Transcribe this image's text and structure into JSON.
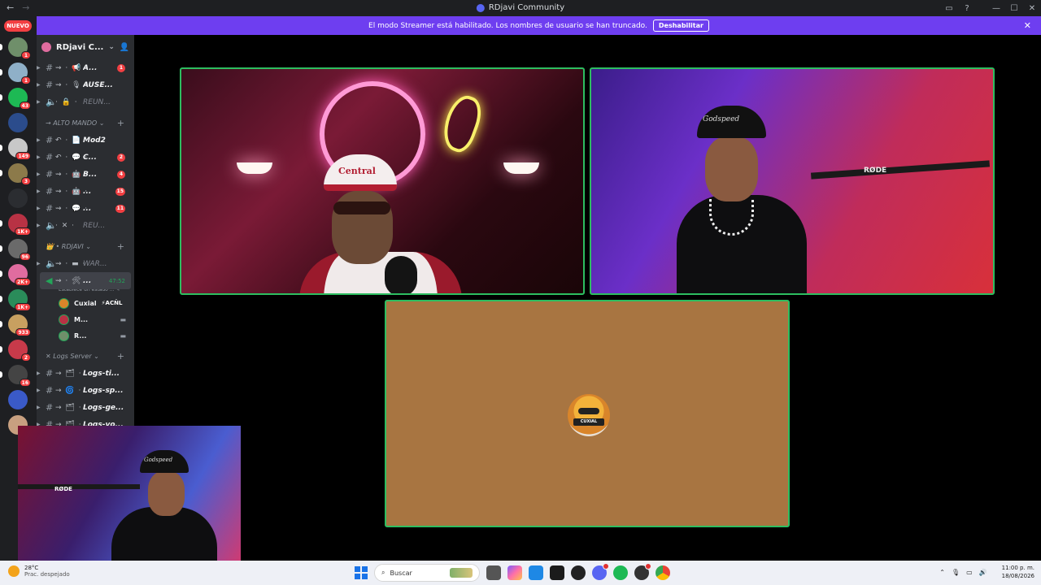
{
  "window": {
    "title": "RDjavi Community",
    "nav_back": "←",
    "nav_forward": "→"
  },
  "banner": {
    "text": "El modo Streamer está habilitado. Los nombres de usuario se han truncado.",
    "button": "Deshabilitar",
    "close": "✕"
  },
  "rail": {
    "nuevo": "NUEVO",
    "servers": [
      {
        "badge": "1",
        "color": "#6f8f6a"
      },
      {
        "badge": "1",
        "color": "#8fb0c8"
      },
      {
        "badge": "43",
        "color": "#1db954"
      },
      {
        "badge": "",
        "color": "#2b4c8c"
      },
      {
        "badge": "149",
        "color": "#c8c8c8"
      },
      {
        "badge": "3",
        "color": "#8c7a4a"
      },
      {
        "badge": "",
        "color": "#2b2d31"
      },
      {
        "badge": "1K+",
        "color": "#b83244"
      },
      {
        "badge": "96",
        "color": "#6a6a6a"
      },
      {
        "badge": "2K+",
        "color": "#e06c9f"
      },
      {
        "badge": "1K+",
        "color": "#2a8c5a"
      },
      {
        "badge": "933",
        "color": "#c8a060"
      },
      {
        "badge": "2",
        "color": "#c83a4a"
      },
      {
        "badge": "16",
        "color": "#444"
      },
      {
        "badge": "",
        "color": "#3a5ac8"
      },
      {
        "badge": "",
        "color": "#c8a080"
      }
    ]
  },
  "server": {
    "name": "RDjavi C...",
    "chevron": "⌄",
    "invite": "👤"
  },
  "channels_top": [
    {
      "deco": "⇝ · 📢 ·",
      "name": "A...",
      "count": "1"
    },
    {
      "deco": "⇝ · 🎙 ·",
      "name": "AUSE...",
      "count": ""
    },
    {
      "deco": "· 🔒 ·",
      "name": "REUN...",
      "count": "",
      "muted": true
    }
  ],
  "cat_alto": "→ ALTO MANDO ⌄",
  "channels_alto": [
    {
      "deco": "↶ · 📄 ·",
      "name": "Mod2",
      "count": ""
    },
    {
      "deco": "↶ · 💬 ·",
      "name": "C...",
      "count": "2"
    },
    {
      "deco": "⇝ · 🤖 ·",
      "name": "B...",
      "count": "4"
    },
    {
      "deco": "⇝ · 🤖 ·",
      "name": "...",
      "count": "15"
    },
    {
      "deco": "⇝ · 💬 ·",
      "name": "...",
      "count": "11"
    },
    {
      "deco": "· ✕ ·",
      "name": "REU...",
      "count": "",
      "muted": true
    }
  ],
  "cat_rdjavi": "👑 • RDJAVI ⌄",
  "channels_rdjavi": [
    {
      "deco": "⇝ · ▬ ·",
      "name": "WAR...",
      "count": "",
      "muted": true
    }
  ],
  "active_channel": {
    "deco": "⇝ · 🛠",
    "name": "...",
    "time": "47:52",
    "status": "Establece un estado ... ✎"
  },
  "voice_users": [
    {
      "name": "Cuxial",
      "tag": "⚡ACÑL",
      "color": "#d9852a"
    },
    {
      "name": "M...",
      "tag": "",
      "color": "#b83244"
    },
    {
      "name": "R...",
      "tag": "",
      "color": "#6f8f6a"
    }
  ],
  "cat_logs": "✕ Logs Server ⌄",
  "channels_logs": [
    {
      "deco": "→ 🗂 ·",
      "name": "Logs-ti..."
    },
    {
      "deco": "→ 🌀 ·",
      "name": "Logs-sp..."
    },
    {
      "deco": "→ 🗂 ·",
      "name": "Logs-ge..."
    },
    {
      "deco": "→ 🗂 ·",
      "name": "Logs-vo..."
    }
  ],
  "stage": {
    "tile1_cap": "Central",
    "tile2_cap": "Godspeed",
    "rode": "RØDE",
    "avatar_label": "CUXIAL"
  },
  "cam_overlay": {
    "cap": "Godspeed",
    "rode": "RØDE"
  },
  "taskbar": {
    "temp": "28°C",
    "weather": "Prac. despejado",
    "search": "Buscar",
    "time": "11:00 p. m.",
    "date": "18/08/2026"
  },
  "colors": {
    "accent": "#5865f2",
    "streamer_banner": "#6e3ef0",
    "speaking_border": "#2dbe60",
    "badge": "#f23f42"
  }
}
